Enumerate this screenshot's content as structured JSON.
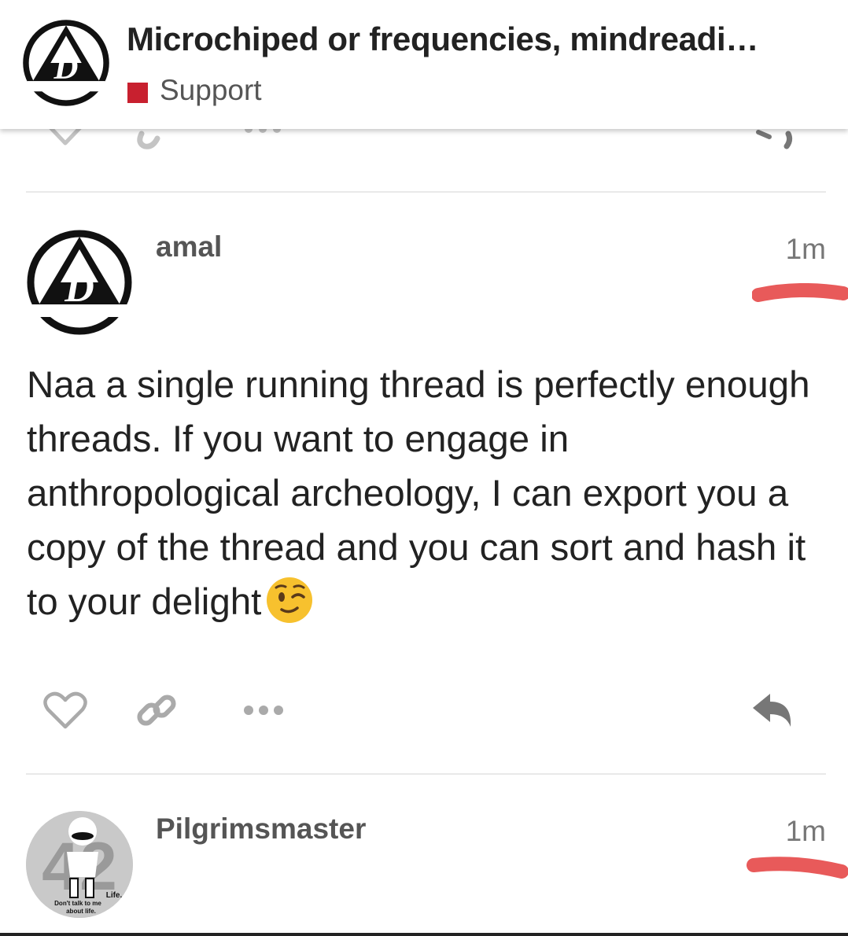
{
  "header": {
    "title": "Microchiped or frequencies, mindreadi…",
    "category": {
      "name": "Support",
      "color": "#c8202f"
    },
    "logo_icon": "triangle-d-logo-icon"
  },
  "posts": [
    {
      "username": "amal",
      "date": "1m",
      "avatar_icon": "triangle-d-logo-icon",
      "body": "Naa a single running thread is perfectly enough threads. If you want to engage in anthropological archeology, I can export you a copy of the thread and you can sort and hash it to your delight",
      "emoji": "winking-face",
      "actions": [
        "like-heart-icon",
        "link-icon",
        "more-ellipsis-icon",
        "reply-arrow-icon"
      ]
    },
    {
      "username": "Pilgrimsmaster",
      "date": "1m",
      "avatar_icon": "marvin-robot-42-avatar",
      "avatar_text": {
        "number": "42",
        "life": "Life.",
        "line1": "Don't talk to me",
        "line2": "about life."
      }
    }
  ],
  "colors": {
    "accent": "#c8202f",
    "annotation": "#e85a5a",
    "icon_gray": "#999999",
    "divider": "#e9e9e9"
  }
}
